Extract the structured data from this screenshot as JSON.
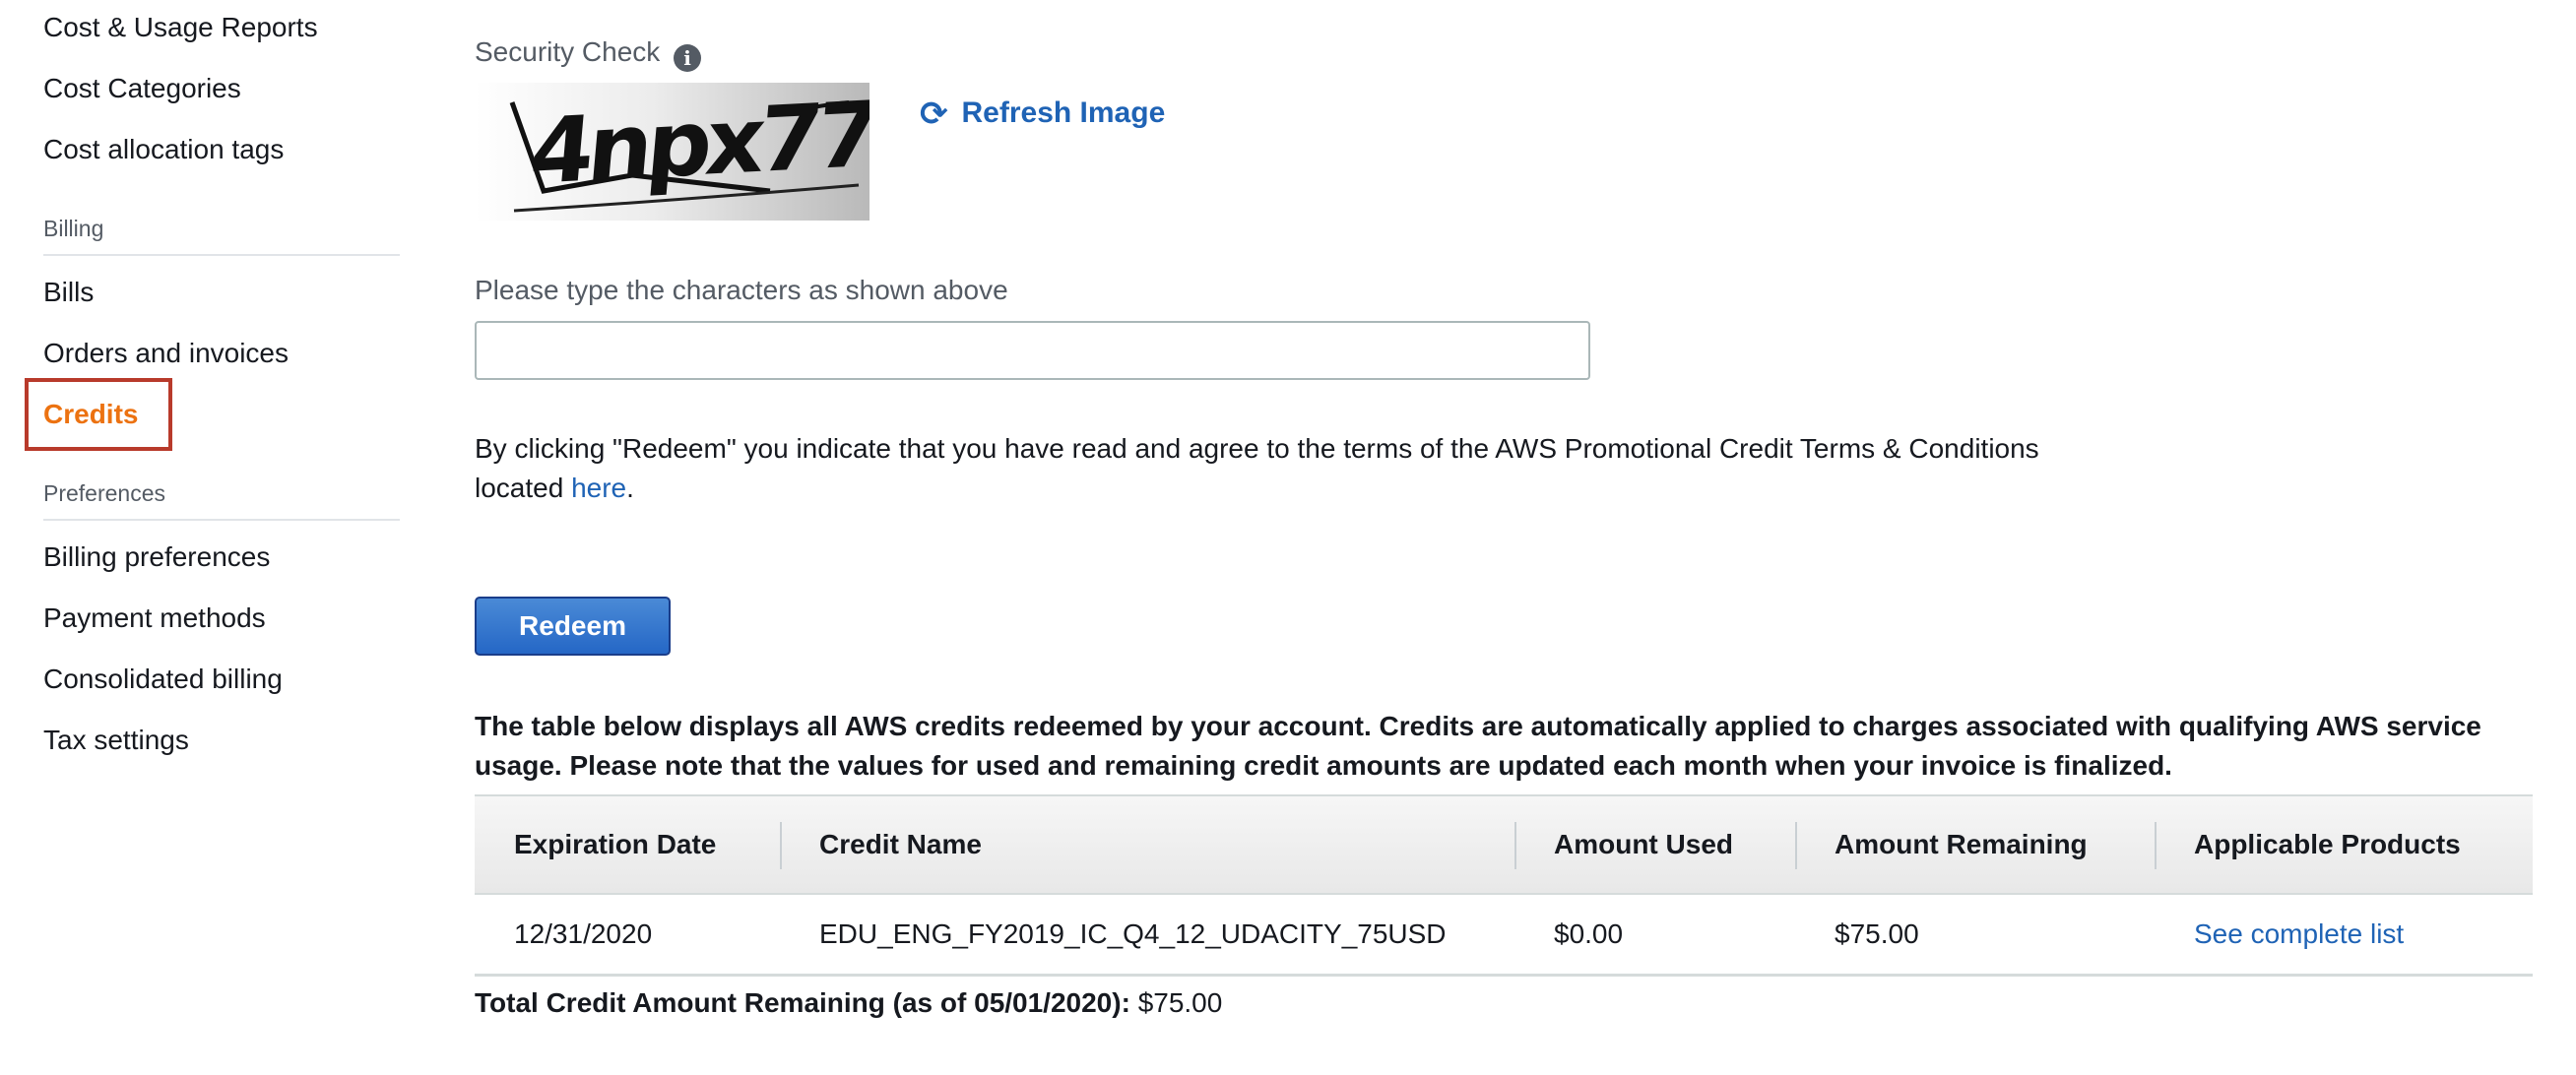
{
  "sidebar": {
    "items_top": [
      {
        "label": "Cost & Usage Reports"
      },
      {
        "label": "Cost Categories"
      },
      {
        "label": "Cost allocation tags"
      }
    ],
    "billing_section": "Billing",
    "billing_items": [
      {
        "label": "Bills"
      },
      {
        "label": "Orders and invoices"
      },
      {
        "label": "Credits",
        "active": true
      }
    ],
    "preferences_section": "Preferences",
    "preferences_items": [
      {
        "label": "Billing preferences"
      },
      {
        "label": "Payment methods"
      },
      {
        "label": "Consolidated billing"
      },
      {
        "label": "Tax settings"
      }
    ],
    "active_color": "#ec7211"
  },
  "main": {
    "security_check_label": "Security Check",
    "info_icon": "info-icon",
    "captcha_text": "4npx77",
    "refresh_label": "Refresh Image",
    "refresh_icon": "refresh-icon",
    "input_label": "Please type the characters as shown above",
    "input_value": "",
    "terms_text": "By clicking \"Redeem\" you indicate that you have read and agree to the terms of the AWS Promotional Credit Terms & Conditions located ",
    "terms_link": "here",
    "terms_end": ".",
    "redeem_label": "Redeem",
    "table_description": "The table below displays all AWS credits redeemed by your account. Credits are automatically applied to charges associated with qualifying AWS service usage. Please note that the values for used and remaining credit amounts are updated each month when your invoice is finalized.",
    "link_color": "#1f63b5",
    "button_color": "#2567c6"
  },
  "table": {
    "columns": [
      "Expiration Date",
      "Credit Name",
      "Amount Used",
      "Amount Remaining",
      "Applicable Products"
    ],
    "rows": [
      {
        "expiration": "12/31/2020",
        "name": "EDU_ENG_FY2019_IC_Q4_12_UDACITY_75USD",
        "used": "$0.00",
        "remaining": "$75.00",
        "products_link": "See complete list"
      }
    ]
  },
  "total": {
    "label": "Total Credit Amount Remaining (as of 05/01/2020):",
    "value": "$75.00"
  }
}
